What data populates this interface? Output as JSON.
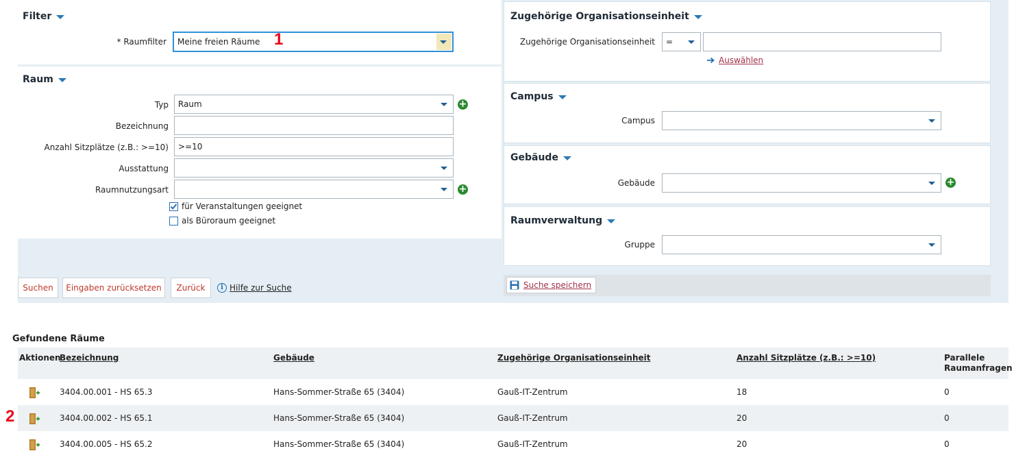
{
  "filter": {
    "title": "Filter",
    "raumfilter_label": "* Raumfilter",
    "raumfilter_value": "Meine freien Räume",
    "marker_1": "1"
  },
  "raum": {
    "title": "Raum",
    "typ_label": "Typ",
    "typ_value": "Raum",
    "bezeichnung_label": "Bezeichnung",
    "bezeichnung_value": "",
    "sitzplaetze_label": "Anzahl Sitzplätze (z.B.: >=10)",
    "sitzplaetze_value": ">=10",
    "ausstattung_label": "Ausstattung",
    "ausstattung_value": "",
    "raumnutzungsart_label": "Raumnutzungsart",
    "raumnutzungsart_value": "",
    "cb_veranstaltungen_label": "für Veranstaltungen geeignet",
    "cb_veranstaltungen_checked": true,
    "cb_bueroraum_label": "als Büroraum geeignet",
    "cb_bueroraum_checked": false
  },
  "orgeinheit": {
    "title": "Zugehörige Organisationseinheit",
    "label": "Zugehörige Organisationseinheit",
    "operator": "=",
    "value": "",
    "auswaehlen_label": "Auswählen"
  },
  "campus": {
    "title": "Campus",
    "label": "Campus",
    "value": ""
  },
  "gebaeude": {
    "title": "Gebäude",
    "label": "Gebäude",
    "value": ""
  },
  "raumverwaltung": {
    "title": "Raumverwaltung",
    "label": "Gruppe",
    "value": ""
  },
  "buttons": {
    "suchen": "Suchen",
    "reset": "Eingaben zurücksetzen",
    "zurueck": "Zurück",
    "hilfe": "Hilfe zur Suche",
    "suche_speichern": "Suche speichern"
  },
  "results": {
    "title": "Gefundene Räume",
    "marker_2": "2",
    "columns": {
      "aktionen": "Aktionen",
      "bezeichnung": "Bezeichnung",
      "gebaeude": "Gebäude",
      "orgeinheit": "Zugehörige Organisationseinheit",
      "sitzplaetze": "Anzahl Sitzplätze (z.B.: >=10)",
      "parallel_line1": "Parallele",
      "parallel_line2": "Raumanfragen"
    },
    "rows": [
      {
        "bezeichnung": "3404.00.001 - HS 65.3",
        "gebaeude": "Hans-Sommer-Straße 65 (3404)",
        "orgeinheit": "Gauß-IT-Zentrum",
        "sitzplaetze": "18",
        "parallel": "0"
      },
      {
        "bezeichnung": "3404.00.002 - HS 65.1",
        "gebaeude": "Hans-Sommer-Straße 65 (3404)",
        "orgeinheit": "Gauß-IT-Zentrum",
        "sitzplaetze": "20",
        "parallel": "0"
      },
      {
        "bezeichnung": "3404.00.005 - HS 65.2",
        "gebaeude": "Hans-Sommer-Straße 65 (3404)",
        "orgeinheit": "Gauß-IT-Zentrum",
        "sitzplaetze": "20",
        "parallel": "0"
      }
    ]
  },
  "colors": {
    "accent_blue": "#2a7ab7",
    "link_red": "#a3324b",
    "button_text_red": "#c0392b",
    "plus_green": "#2a8a2f",
    "marker_red": "#e8091a",
    "panel_bg": "#e4eef4"
  },
  "icons": [
    "chevron-down-icon",
    "plus-circle-icon",
    "arrow-right-icon",
    "info-icon",
    "save-icon",
    "room-request-icon",
    "checkbox-icon"
  ]
}
